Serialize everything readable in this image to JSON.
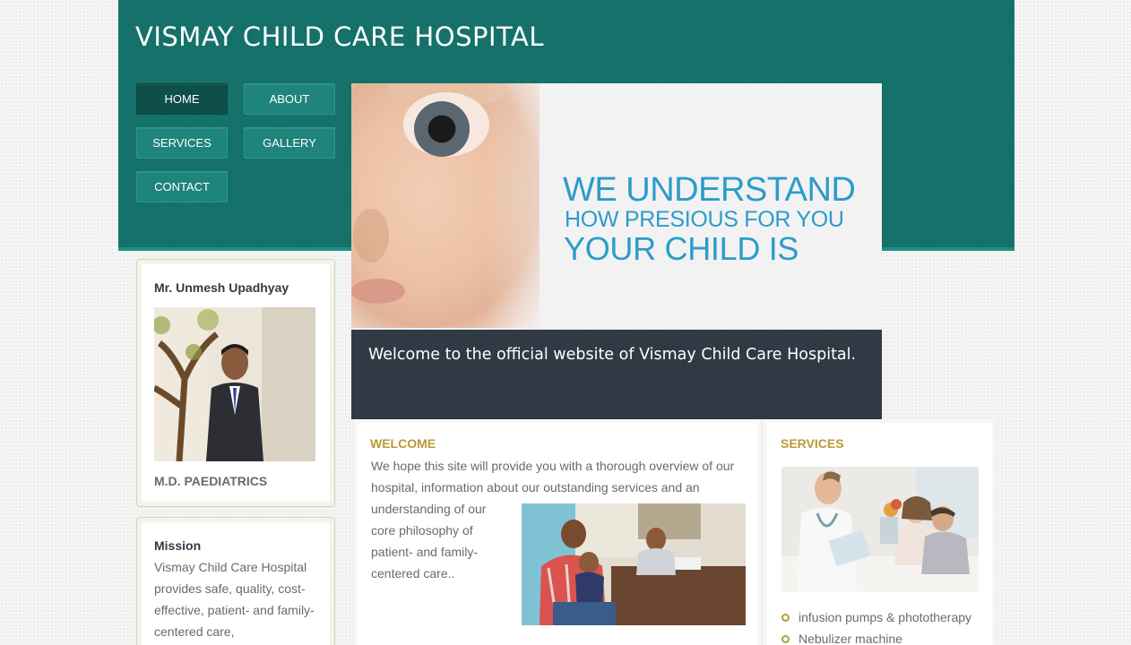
{
  "header": {
    "title": "VISMAY CHILD CARE HOSPITAL"
  },
  "nav": {
    "home": "HOME",
    "about": "ABOUT",
    "services": "SERVICES",
    "gallery": "GALLERY",
    "contact": "CONTACT",
    "active": "HOME"
  },
  "hero": {
    "line1": "WE UNDERSTAND",
    "line2": "HOW PRESIOUS FOR YOU",
    "line3": "YOUR CHILD IS"
  },
  "welcome_banner": {
    "text": "Welcome to the official website of Vismay Child Care Hospital."
  },
  "doctor_card": {
    "name": "Mr. Unmesh Upadhyay",
    "qualification": "M.D. PAEDIATRICS"
  },
  "mission_card": {
    "title": "Mission",
    "body": "Vismay Child Care Hospital provides safe, quality, cost-effective, patient- and family-centered care,"
  },
  "welcome_section": {
    "title": "WELCOME",
    "intro": "We hope this site will provide you with a thorough overview of our hospital, information about our outstanding services and an",
    "continued": "understanding of our core philosophy of patient- and family-centered care.."
  },
  "services_section": {
    "title": "SERVICES",
    "items": [
      "infusion pumps & phototherapy",
      "Nebulizer machine"
    ]
  },
  "colors": {
    "header_bg": "#137068",
    "nav_btn": "#1f847b",
    "nav_active": "#0f4f49",
    "banner_bg": "#303a44",
    "hero_text": "#2b9ccb",
    "accent_gold": "#b99a3a"
  }
}
